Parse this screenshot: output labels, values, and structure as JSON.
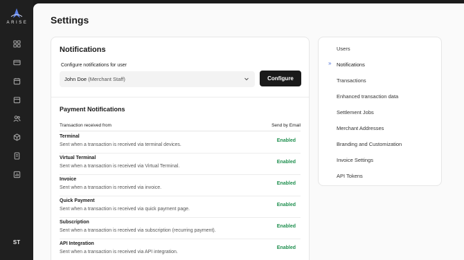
{
  "brand": {
    "name": "ARISE"
  },
  "sidebar": {
    "icons": [
      "grid-icon",
      "credit-card-icon",
      "calendar-icon",
      "store-icon",
      "users-icon",
      "box-icon",
      "document-icon",
      "bar-chart-icon"
    ],
    "avatar_initials": "ST"
  },
  "page": {
    "title": "Settings"
  },
  "notifications": {
    "title": "Notifications",
    "configure_label": "Configure notifications for user",
    "selected_user": "John Doe",
    "selected_user_role": "(Merchant Staff)",
    "configure_button": "Configure",
    "section_title": "Payment Notifications",
    "col_left": "Transaction received from",
    "col_right": "Send by Email",
    "rows": [
      {
        "title": "Terminal",
        "desc": "Sent when a transaction is received via terminal devices.",
        "status": "Enabled"
      },
      {
        "title": "Virtual Terminal",
        "desc": "Sent when a transaction is received via Virtual Terminal.",
        "status": "Enabled"
      },
      {
        "title": "Invoice",
        "desc": "Sent when a transaction is received via invoice.",
        "status": "Enabled"
      },
      {
        "title": "Quick Payment",
        "desc": "Sent when a transaction is received via quick payment page.",
        "status": "Enabled"
      },
      {
        "title": "Subscription",
        "desc": "Sent when a transaction is received via subscription (recurring payment).",
        "status": "Enabled"
      },
      {
        "title": "API Integration",
        "desc": "Sent when a transaction is received via API integration.",
        "status": "Enabled"
      }
    ]
  },
  "settings_menu": {
    "active_marker": "»",
    "items": [
      {
        "label": "Users"
      },
      {
        "label": "Notifications"
      },
      {
        "label": "Transactions"
      },
      {
        "label": "Enhanced transaction data"
      },
      {
        "label": "Settlement Jobs"
      },
      {
        "label": "Merchant Addresses"
      },
      {
        "label": "Branding and Customization"
      },
      {
        "label": "Invoice Settings"
      },
      {
        "label": "API Tokens"
      }
    ]
  },
  "colors": {
    "accent": "#4a6fd8",
    "enabled": "#1e8f4e",
    "primary_button": "#1a1a1a",
    "sidebar": "#1f1f1f"
  }
}
